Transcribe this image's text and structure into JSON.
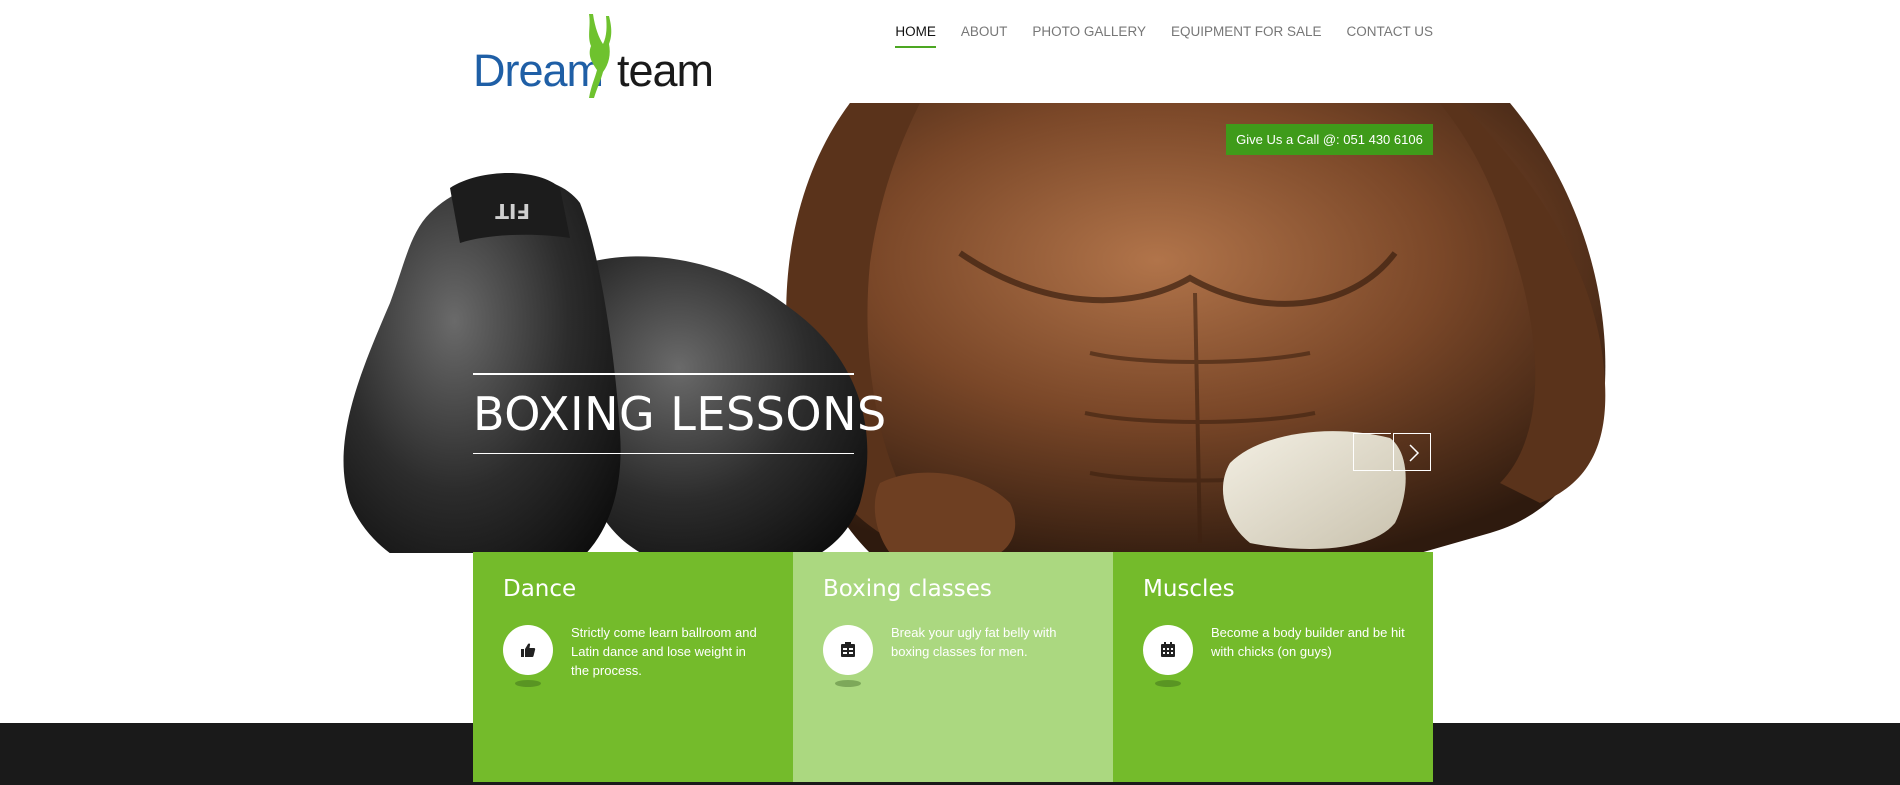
{
  "brand": {
    "logo_word_1": "Dream",
    "logo_word_2": "team",
    "colors": {
      "blue": "#1f5fa6",
      "green": "#4ca722"
    }
  },
  "nav": {
    "items": [
      {
        "label": "HOME",
        "active": true
      },
      {
        "label": "ABOUT",
        "active": false
      },
      {
        "label": "PHOTO GALLERY",
        "active": false
      },
      {
        "label": "EQUIPMENT FOR SALE",
        "active": false
      },
      {
        "label": "CONTACT US",
        "active": false
      }
    ]
  },
  "hero": {
    "call_badge": "Give Us a Call @: 051 430 6106",
    "slide_title": "BOXING LESSONS",
    "glove_brand": "FIT",
    "prev_icon": "chevron-left-icon",
    "next_icon": "chevron-right-icon"
  },
  "features": [
    {
      "title": "Dance",
      "text": "Strictly come learn ballroom and Latin dance and lose weight in the process.",
      "icon": "thumbs-up-icon"
    },
    {
      "title": "Boxing classes",
      "text": "Break your ugly fat belly with boxing classes for men.",
      "icon": "schedule-board-icon"
    },
    {
      "title": "Muscles",
      "text": "Become a body builder and be hit with chicks (on guys)",
      "icon": "calendar-icon"
    }
  ]
}
